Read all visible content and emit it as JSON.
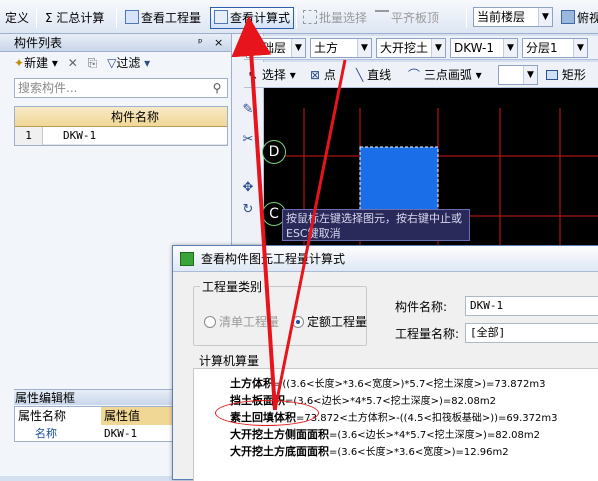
{
  "toolbar": {
    "define_label": "定义",
    "sum_label": "汇总计算",
    "view_qty_label": "查看工程量",
    "view_formula_label": "查看计算式",
    "batch_select_label": "批量选择",
    "level_top_label": "平齐板顶",
    "floor_value": "当前楼层",
    "view_label": "俯视"
  },
  "left_panel": {
    "title": "构件列表",
    "pin": "ᵖ",
    "close": "×",
    "new_label": "新建",
    "filter_label": "过滤",
    "search_placeholder": "搜索构件...",
    "col_name": "构件名称",
    "rows": [
      {
        "n": "1",
        "name": "DKW-1"
      }
    ],
    "attr_title": "属性编辑框",
    "attr_col_name": "属性名称",
    "attr_col_value": "属性值",
    "attr_row_name": "名称",
    "attr_row_value": "DKW-1"
  },
  "drawing_toolbar": {
    "layer": "基础层",
    "type": "土方",
    "subtype": "大开挖土",
    "element": "DKW-1",
    "sublayer": "分层1",
    "select_label": "选择",
    "point_label": "点",
    "line_label": "直线",
    "arc_label": "三点画弧",
    "rect_label": "矩形"
  },
  "canvas": {
    "axis_d": "D",
    "axis_c": "C",
    "tooltip": "按鼠标左键选择图元，按右键中止或ESC键取消"
  },
  "dialog": {
    "title": "查看构件图元工程量计算式",
    "qty_type_label": "工程量类别",
    "radio_list": "清单工程量",
    "radio_quota": "定额工程量",
    "comp_name_label": "构件名称:",
    "comp_name_value": "DKW-1",
    "qty_name_label": "工程量名称:",
    "qty_name_value": "[全部]",
    "calc_label": "计算机算量",
    "formulas": [
      {
        "name": "土方体积",
        "expr": "=((3.6<长度>*3.6<宽度>)*5.7<挖土深度>)=73.872m3"
      },
      {
        "name": "挡土板面积",
        "expr": "=(3.6<边长>*4*5.7<挖土深度>)=82.08m2"
      },
      {
        "name": "素土回填体积",
        "expr": "=73.872<土方体积>-((4.5<扣筏板基础>))=69.372m3"
      },
      {
        "name": "大开挖土方侧面面积",
        "expr": "=(3.6<边长>*4*5.7<挖土深度>)=82.08m2"
      },
      {
        "name": "大开挖土方底面面积",
        "expr": "=(3.6<长度>*3.6<宽度>)=12.96m2"
      }
    ]
  },
  "colors": {
    "accent": "#2d5fae",
    "annotation": "#e02020",
    "canvas_line": "#d01818",
    "selected": "#1a6fe8"
  }
}
